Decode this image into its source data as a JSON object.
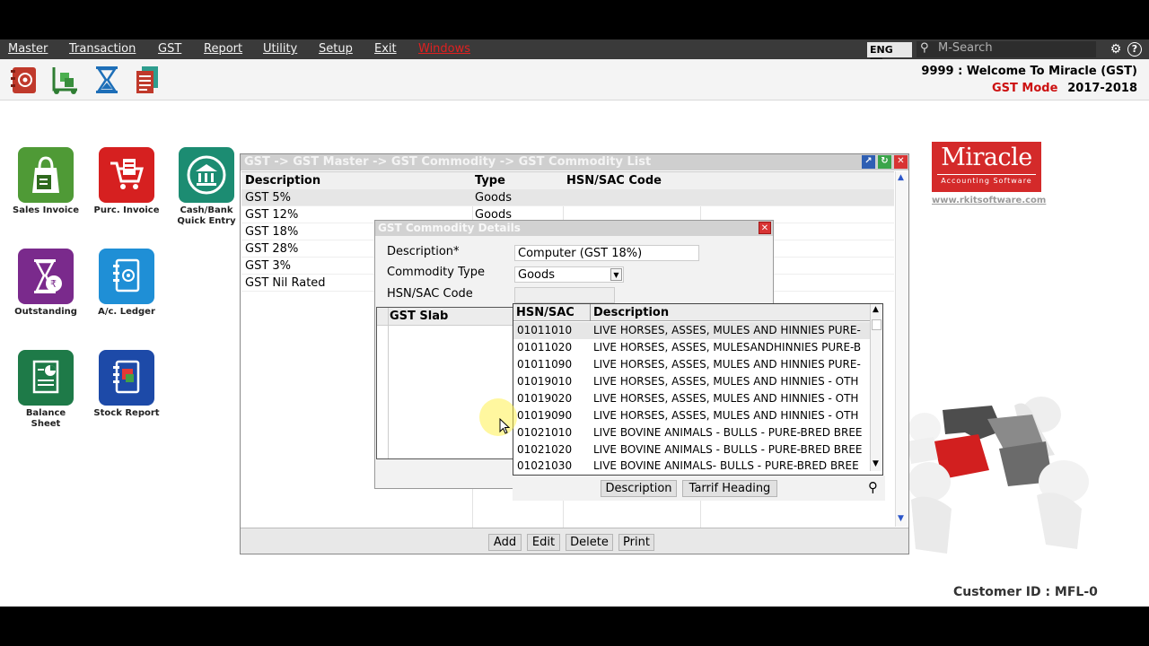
{
  "menu": [
    "Master",
    "Transaction",
    "GST",
    "Report",
    "Utility",
    "Setup",
    "Exit",
    "Windows"
  ],
  "lang": "ENG",
  "search": {
    "placeholder": "M-Search"
  },
  "header": {
    "welcome": "9999 : Welcome To Miracle (GST)",
    "mode": "GST Mode",
    "year": "2017-2018"
  },
  "tiles": [
    "Sales Invoice",
    "Purc. Invoice",
    "Cash/Bank Quick Entry",
    "Outstanding",
    "A/c. Ledger",
    "Balance Sheet",
    "Stock Report"
  ],
  "logo": {
    "name": "Miracle",
    "tagline": "Accounting Software",
    "url": "www.rkitsoftware.com"
  },
  "customer": "Customer ID : MFL-0",
  "list_window": {
    "title": "GST -> GST Master -> GST Commodity -> GST Commodity List",
    "columns": [
      "Description",
      "Type",
      "HSN/SAC Code"
    ],
    "rows": [
      [
        "GST  5%",
        "Goods",
        ""
      ],
      [
        "GST 12%",
        "Goods",
        ""
      ],
      [
        "GST 18%",
        "",
        ""
      ],
      [
        "GST 28%",
        "",
        ""
      ],
      [
        "GST 3%",
        "",
        ""
      ],
      [
        "GST Nil Rated",
        "",
        ""
      ]
    ],
    "buttons": [
      "Add",
      "Edit",
      "Delete",
      "Print"
    ]
  },
  "detail": {
    "title": "GST Commodity Details",
    "description_label": "Description*",
    "description_value": "Computer (GST 18%)",
    "type_label": "Commodity Type",
    "type_value": "Goods",
    "hsn_label": "HSN/SAC Code",
    "slab_header": "GST Slab"
  },
  "hsn_popup": {
    "columns": [
      "HSN/SAC",
      "Description"
    ],
    "rows": [
      [
        "01011010",
        "LIVE HORSES, ASSES, MULES AND HINNIES PURE-"
      ],
      [
        "01011020",
        "LIVE HORSES, ASSES, MULESANDHINNIES PURE-B"
      ],
      [
        "01011090",
        "LIVE HORSES, ASSES, MULES AND HINNIES PURE-"
      ],
      [
        "01019010",
        "LIVE HORSES, ASSES, MULES AND HINNIES - OTH"
      ],
      [
        "01019020",
        "LIVE HORSES, ASSES, MULES AND HINNIES - OTH"
      ],
      [
        "01019090",
        "LIVE HORSES, ASSES, MULES AND HINNIES - OTH"
      ],
      [
        "01021010",
        "LIVE BOVINE ANIMALS - BULLS - PURE-BRED BREE"
      ],
      [
        "01021020",
        "LIVE BOVINE ANIMALS - BULLS - PURE-BRED BREE"
      ],
      [
        "01021030",
        "LIVE BOVINE ANIMALS- BULLS - PURE-BRED BREE"
      ]
    ],
    "buttons": [
      "Description",
      "Tarrif Heading"
    ]
  }
}
